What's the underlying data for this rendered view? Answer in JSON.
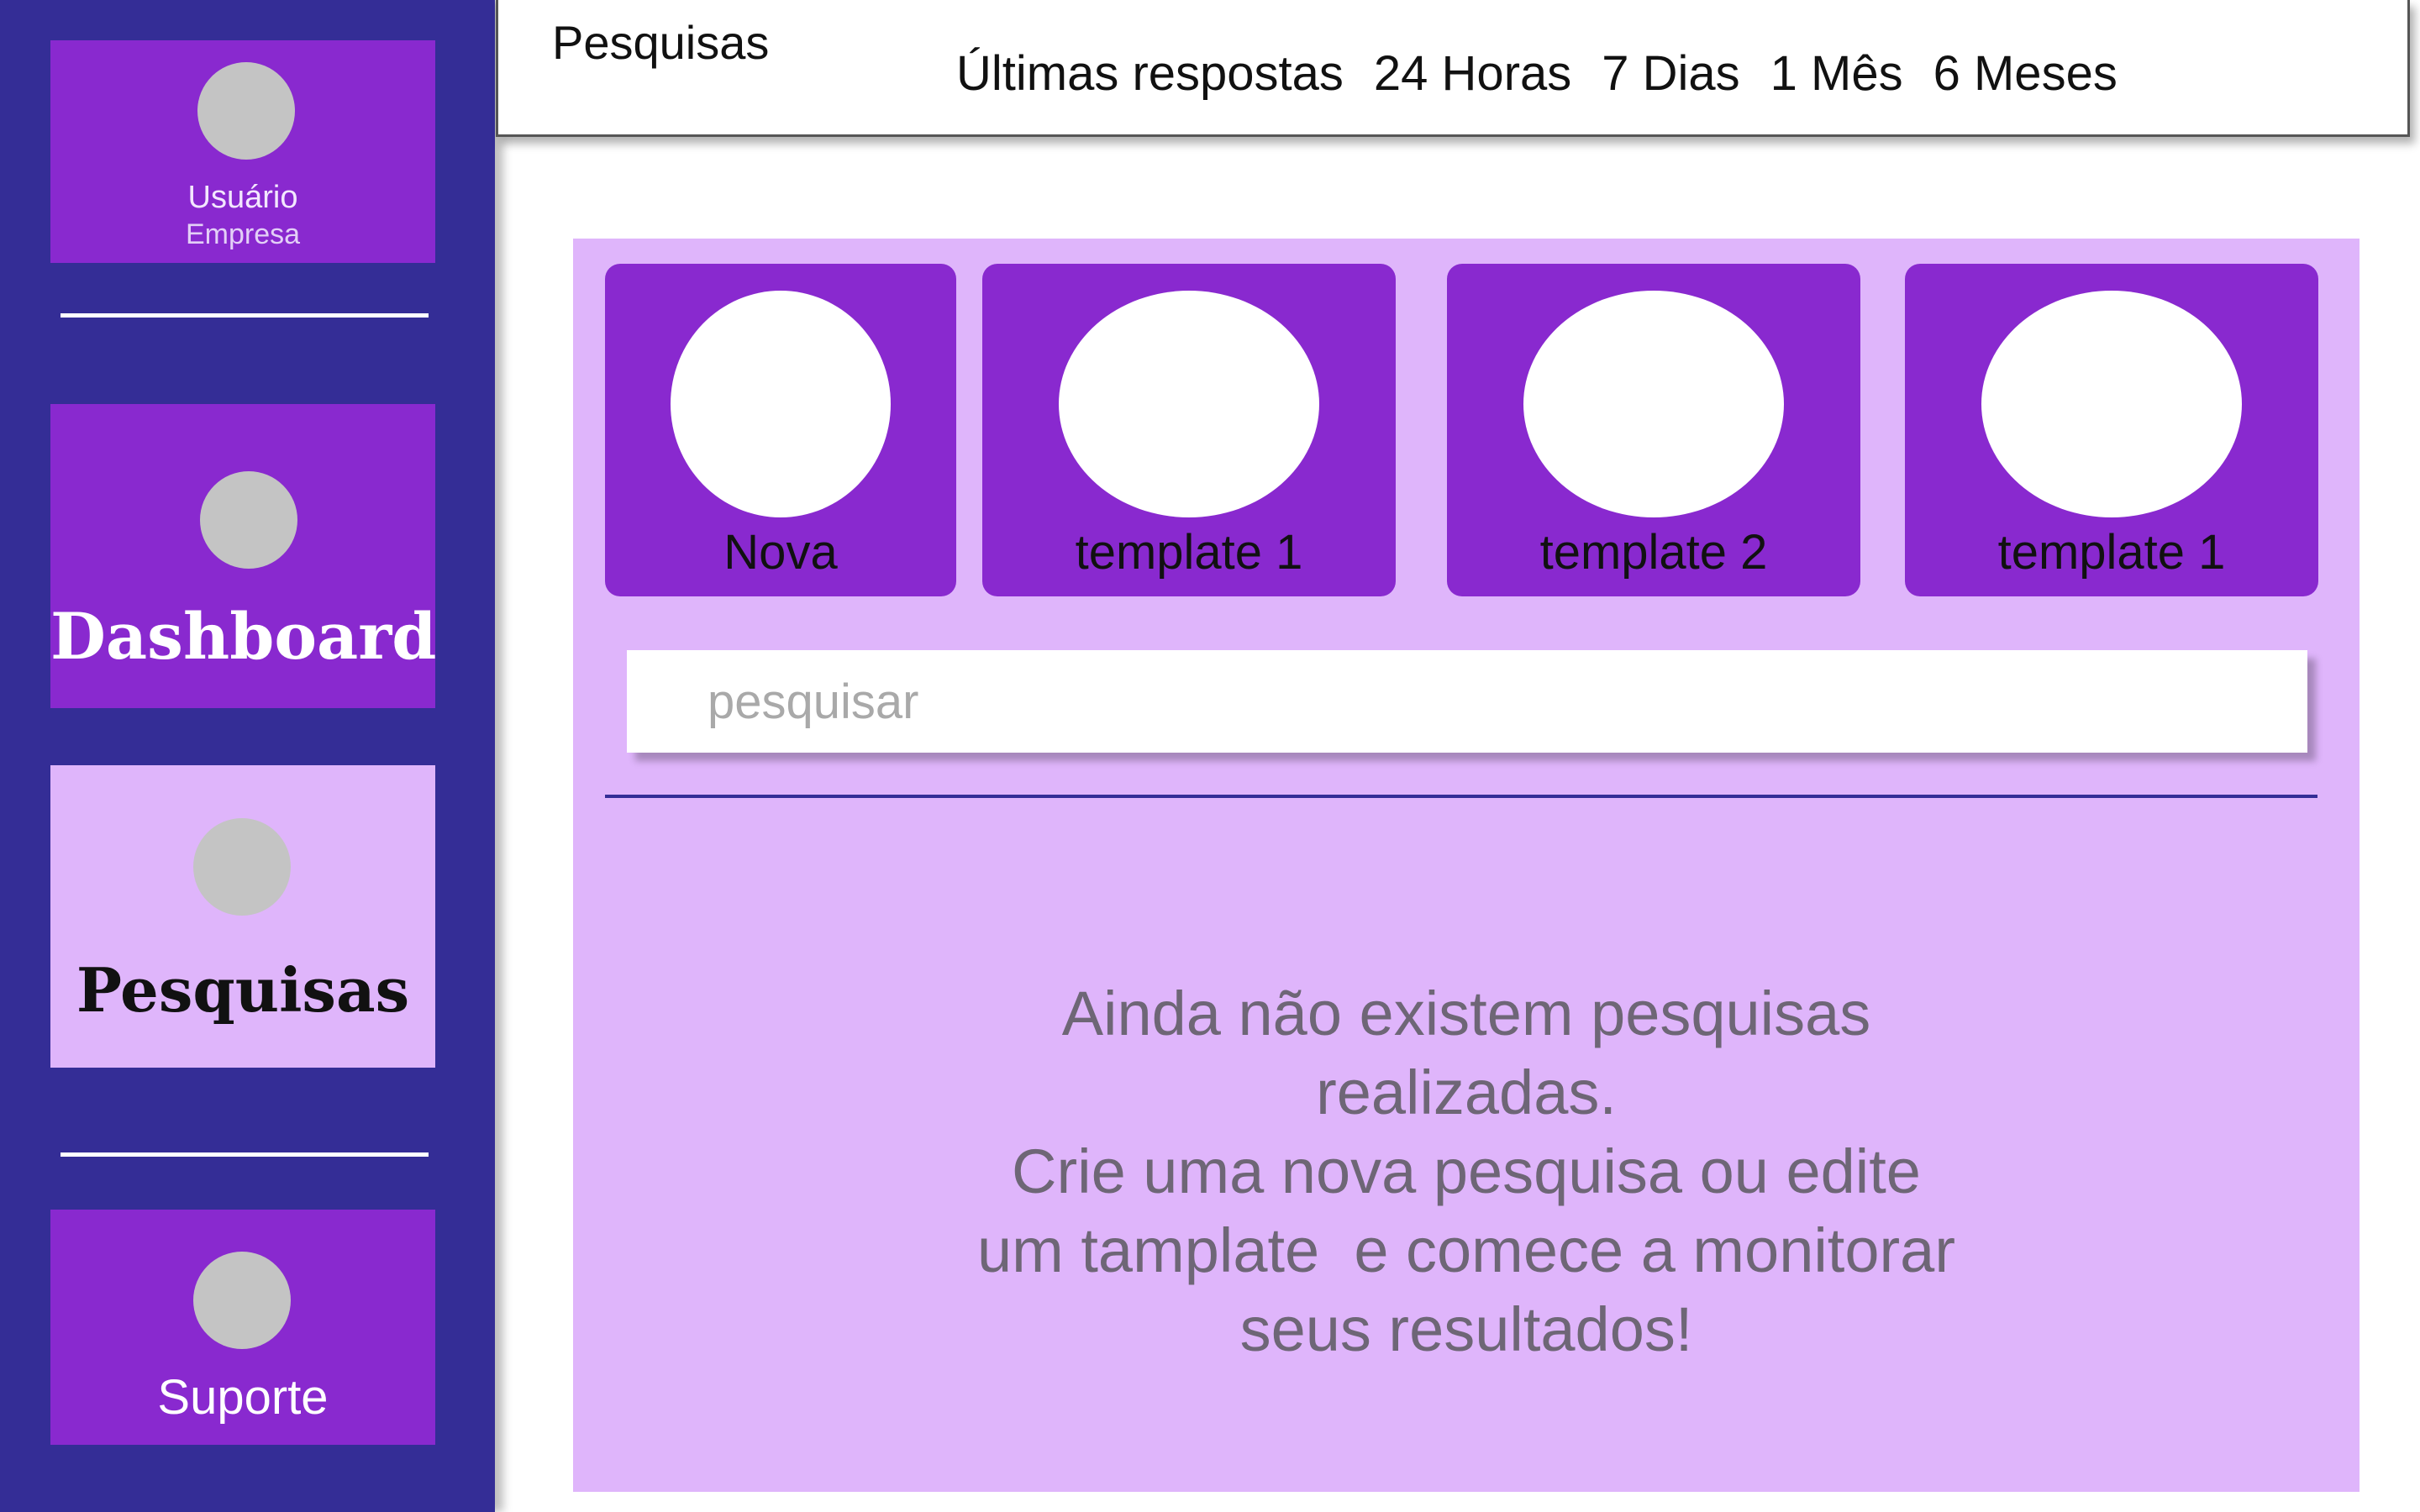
{
  "sidebar": {
    "user": {
      "name": "Usuário",
      "company": "Empresa"
    },
    "items": [
      {
        "label": "Dashboard"
      },
      {
        "label": "Pesquisas",
        "active": true
      },
      {
        "label": "Suporte"
      }
    ]
  },
  "topbar": {
    "title": "Pesquisas",
    "filters": [
      "Últimas respostas",
      "24 Horas",
      "7 Dias",
      "1 Mês",
      "6 Meses"
    ]
  },
  "templates": [
    {
      "label": "Nova"
    },
    {
      "label": "template 1"
    },
    {
      "label": "template 2"
    },
    {
      "label": "template 1"
    }
  ],
  "search": {
    "placeholder": "pesquisar"
  },
  "empty_message": {
    "lines": [
      "Ainda não existem pesquisas",
      "realizadas.",
      "Crie uma nova pesquisa ou edite",
      "um tamplate  e comece a monitorar",
      "seus resultados!"
    ]
  },
  "colors": {
    "sidebar_bg": "#342d96",
    "card_purple": "#8929cf",
    "panel_lilac": "#dfb5fb",
    "avatar_gray": "#c4c4c4",
    "message_gray": "#6e6676"
  }
}
